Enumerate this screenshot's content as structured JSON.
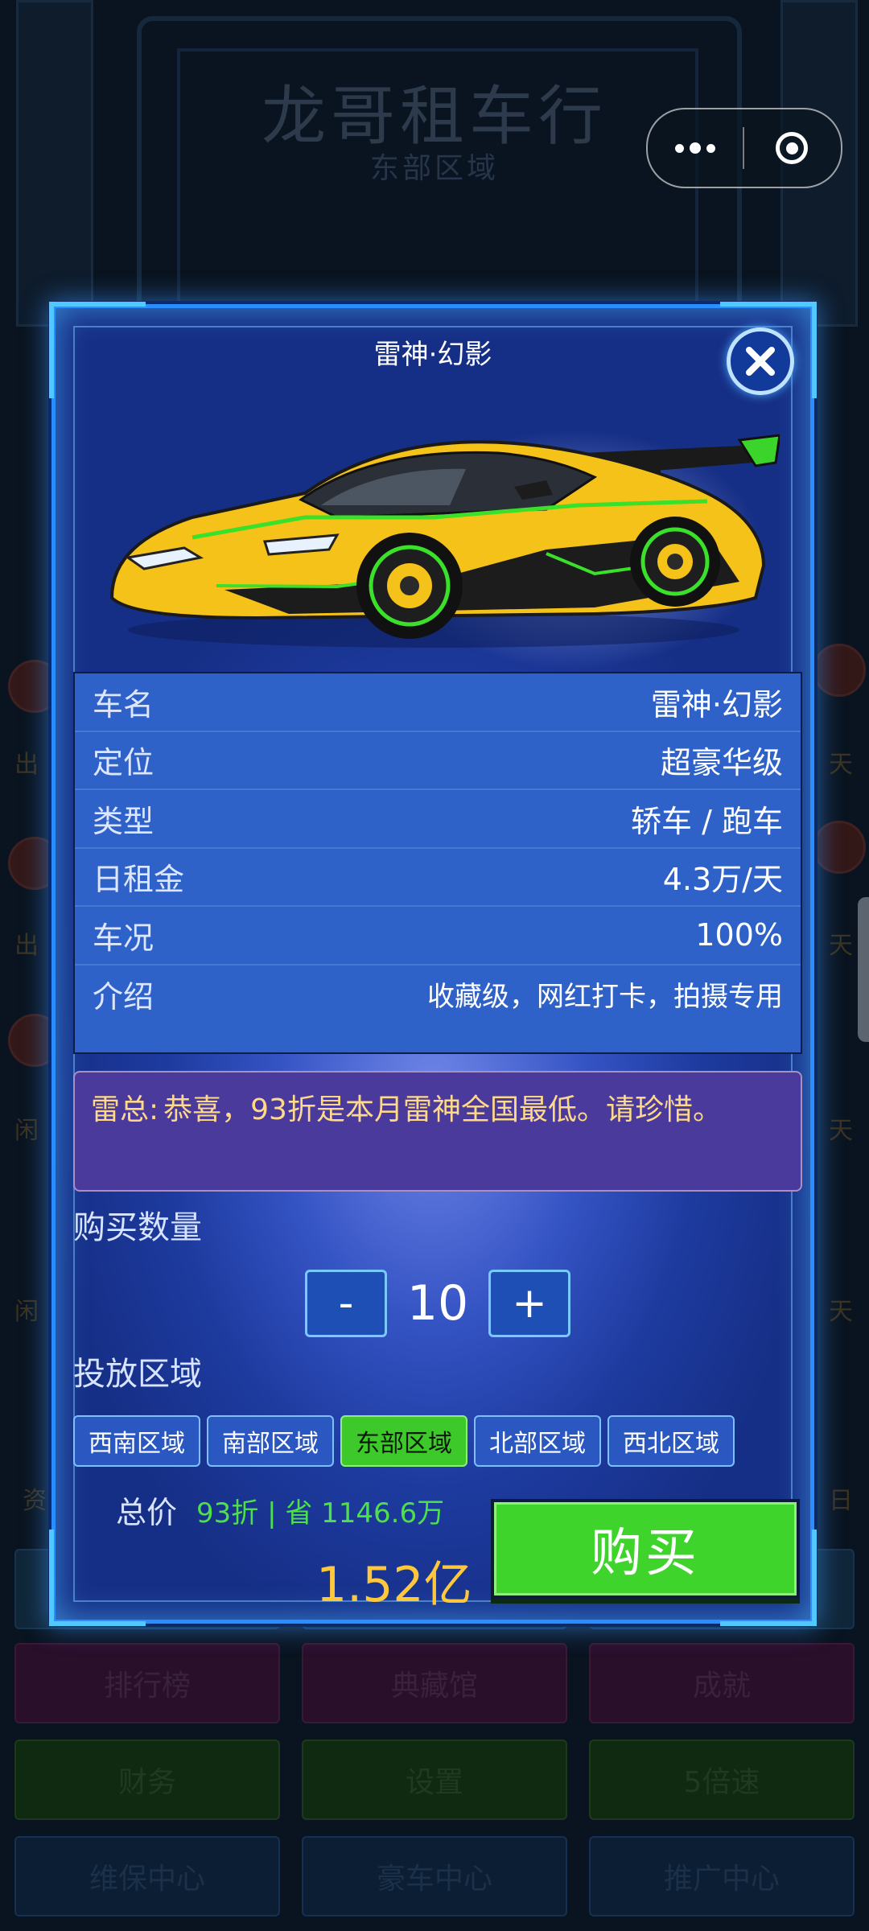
{
  "background": {
    "title": "龙哥租车行",
    "subtitle": "东部区域",
    "menu_rows": [
      [
        "排行榜",
        "典藏馆",
        "成就"
      ],
      [
        "财务",
        "设置",
        "5倍速"
      ],
      [
        "维保中心",
        "豪车中心",
        "推广中心"
      ]
    ],
    "side_labels": [
      "出",
      "出",
      "闲",
      "闲",
      "天",
      "天",
      "天",
      "天",
      "资",
      "日"
    ]
  },
  "capsule": {
    "more_icon": "more-dots-icon",
    "close_icon": "target-circle-icon"
  },
  "modal": {
    "title": "雷神·幻影",
    "car_image": "yellow-supercar",
    "info": [
      {
        "label": "车名",
        "value": "雷神·幻影"
      },
      {
        "label": "定位",
        "value": "超豪华级"
      },
      {
        "label": "类型",
        "value": "轿车 / 跑车"
      },
      {
        "label": "日租金",
        "value": "4.3万/天"
      },
      {
        "label": "车况",
        "value": "100%"
      },
      {
        "label": "介绍",
        "value": "收藏级，网红打卡，拍摄专用"
      }
    ],
    "message": {
      "speaker": "雷总:",
      "text": "恭喜，93折是本月雷神全国最低。请珍惜。"
    },
    "quantity": {
      "label": "购买数量",
      "minus": "-",
      "value": "10",
      "plus": "+"
    },
    "region": {
      "label": "投放区域",
      "options": [
        "西南区域",
        "南部区域",
        "东部区域",
        "北部区域",
        "西北区域"
      ],
      "selected": "东部区域"
    },
    "total": {
      "label": "总价",
      "discount": "93折 | 省 1146.6万",
      "price": "1.52亿"
    },
    "buy_label": "购买"
  },
  "colors": {
    "accent_green": "#3fd42c",
    "price_gold": "#ffc83a",
    "frame_blue": "#2c8dff"
  }
}
